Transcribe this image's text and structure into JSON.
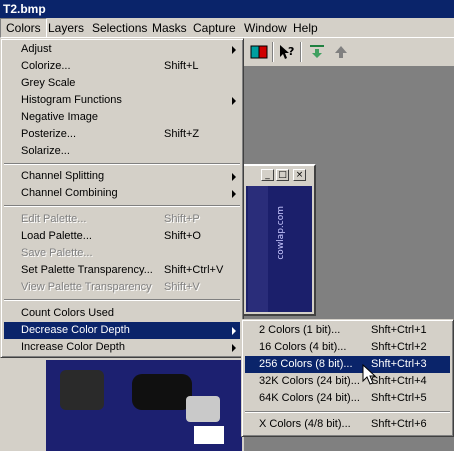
{
  "window": {
    "title": "T2.bmp"
  },
  "menubar": [
    "Colors",
    "Layers",
    "Selections",
    "Masks",
    "Capture",
    "Window",
    "Help"
  ],
  "colors_menu": {
    "group1": [
      {
        "label": "Adjust",
        "shortcut": "",
        "submenu": true,
        "enabled": true
      },
      {
        "label": "Colorize...",
        "shortcut": "Shift+L",
        "submenu": false,
        "enabled": true
      },
      {
        "label": "Grey Scale",
        "shortcut": "",
        "submenu": false,
        "enabled": true
      },
      {
        "label": "Histogram Functions",
        "shortcut": "",
        "submenu": true,
        "enabled": true
      },
      {
        "label": "Negative Image",
        "shortcut": "",
        "submenu": false,
        "enabled": true
      },
      {
        "label": "Posterize...",
        "shortcut": "Shift+Z",
        "submenu": false,
        "enabled": true
      },
      {
        "label": "Solarize...",
        "shortcut": "",
        "submenu": false,
        "enabled": true
      }
    ],
    "group2": [
      {
        "label": "Channel Splitting",
        "shortcut": "",
        "submenu": true,
        "enabled": true
      },
      {
        "label": "Channel Combining",
        "shortcut": "",
        "submenu": true,
        "enabled": true
      }
    ],
    "group3": [
      {
        "label": "Edit Palette...",
        "shortcut": "Shift+P",
        "submenu": false,
        "enabled": false
      },
      {
        "label": "Load Palette...",
        "shortcut": "Shift+O",
        "submenu": false,
        "enabled": true
      },
      {
        "label": "Save Palette...",
        "shortcut": "",
        "submenu": false,
        "enabled": false
      },
      {
        "label": "Set Palette Transparency...",
        "shortcut": "Shift+Ctrl+V",
        "submenu": false,
        "enabled": true
      },
      {
        "label": "View Palette Transparency",
        "shortcut": "Shift+V",
        "submenu": false,
        "enabled": false
      }
    ],
    "group4": [
      {
        "label": "Count Colors Used",
        "shortcut": "",
        "submenu": false,
        "enabled": true
      },
      {
        "label": "Decrease Color Depth",
        "shortcut": "",
        "submenu": true,
        "enabled": true,
        "highlighted": true
      },
      {
        "label": "Increase Color Depth",
        "shortcut": "",
        "submenu": true,
        "enabled": true
      }
    ]
  },
  "decrease_submenu": {
    "group1": [
      {
        "label": "2 Colors (1 bit)...",
        "shortcut": "Shft+Ctrl+1"
      },
      {
        "label": "16 Colors (4 bit)...",
        "shortcut": "Shft+Ctrl+2"
      },
      {
        "label": "256 Colors (8 bit)...",
        "shortcut": "Shft+Ctrl+3",
        "highlighted": true
      },
      {
        "label": "32K Colors (24 bit)...",
        "shortcut": "Shft+Ctrl+4"
      },
      {
        "label": "64K Colors (24 bit)...",
        "shortcut": "Shft+Ctrl+5"
      }
    ],
    "group2": [
      {
        "label": "X Colors (4/8 bit)...",
        "shortcut": "Shft+Ctrl+6"
      }
    ]
  },
  "image_window": {
    "side_text": "cowlap.com",
    "buttons": [
      "_",
      "□",
      "×"
    ]
  },
  "toolbar_icons": [
    "palette-icon",
    "help-cursor-icon",
    "arrow-down-icon",
    "arrow-up-icon"
  ]
}
